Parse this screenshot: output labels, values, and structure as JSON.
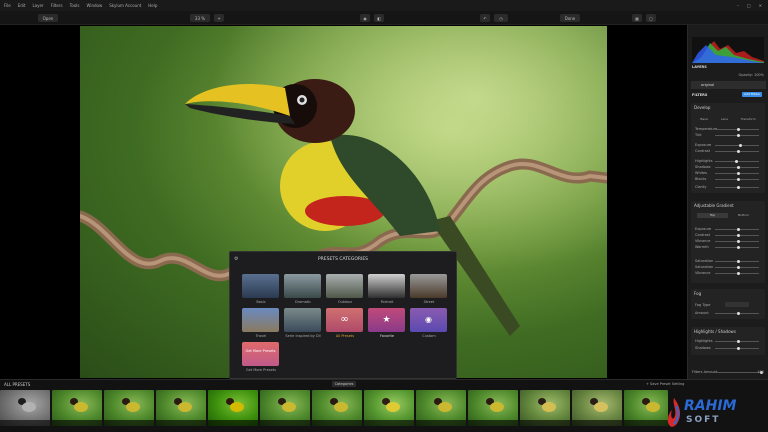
{
  "menu": [
    "File",
    "Edit",
    "Layer",
    "Filters",
    "Tools",
    "Window",
    "Skylum Account",
    "Help"
  ],
  "toolbar": {
    "left_button": "Open",
    "zoom_label": "33 %",
    "right_button": "Done"
  },
  "modal": {
    "title": "PRESETS CATEGORIES",
    "tiles": [
      {
        "label": "Basic"
      },
      {
        "label": "Dramatic"
      },
      {
        "label": "Outdoor"
      },
      {
        "label": "Portrait"
      },
      {
        "label": "Street"
      },
      {
        "label": "Travel"
      },
      {
        "label": "Serie Inspired by Dil"
      },
      {
        "label": "All Presets"
      },
      {
        "label": "Favorite"
      },
      {
        "label": "Custom"
      },
      {
        "label": "Get More Presets"
      }
    ],
    "get_more_text": "Get More Presets"
  },
  "right_panel": {
    "layers_title": "LAYERS",
    "layer_name": "original",
    "opacity_label": "Opacity: 100%",
    "filters_title": "FILTERS",
    "add_filters": "Add Filters",
    "sections": [
      {
        "title": "Develop",
        "rows": [
          "Temperature",
          "Tint",
          "Exposure",
          "Contrast",
          "Highlights",
          "Shadows",
          "Whites",
          "Blacks",
          "Clarity"
        ]
      },
      {
        "title": "Adjustable Gradient",
        "rows": [
          "Exposure",
          "Contrast",
          "Vibrance",
          "Warmth",
          "Saturation",
          "Saturation",
          "Vibrance"
        ]
      },
      {
        "title": "Fog",
        "rows": [
          "Fog Type",
          "Amount"
        ]
      },
      {
        "title": "Highlights / Shadows",
        "rows": [
          "Highlights",
          "Shadows"
        ]
      }
    ],
    "tabs": [
      "Basic",
      "Lens",
      "Transform"
    ],
    "grad_tabs": [
      "Top",
      "Bottom"
    ],
    "filters_amount": "Filters Amount",
    "filters_amount_value": "100"
  },
  "filmstrip": {
    "label": "ALL PRESETS",
    "categories_button": "Categories",
    "save_button": "+ Save Preset Setting"
  },
  "watermark": {
    "line1": "RAHIM",
    "line2": "SOFT"
  },
  "colors": {
    "accent": "#3a8ee6",
    "panel": "#1c1c1c",
    "modal": "#1d1d1f"
  }
}
